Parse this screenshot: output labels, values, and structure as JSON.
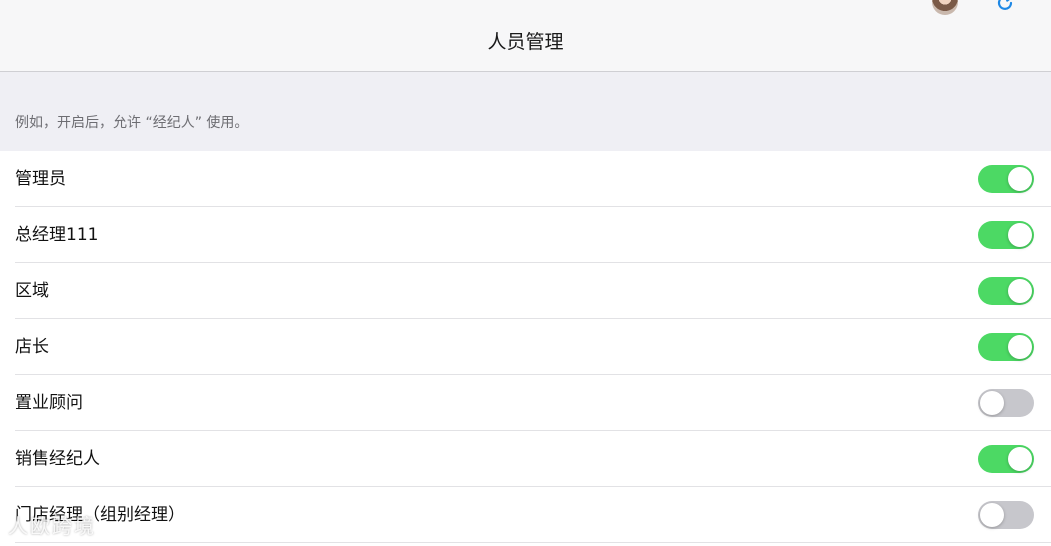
{
  "header": {
    "title": "人员管理"
  },
  "section": {
    "note": "例如，开启后，允许 “经纪人” 使用。"
  },
  "roles": [
    {
      "label": "管理员",
      "enabled": true
    },
    {
      "label": "总经理111",
      "enabled": true
    },
    {
      "label": "区域",
      "enabled": true
    },
    {
      "label": "店长",
      "enabled": true
    },
    {
      "label": "置业顾问",
      "enabled": false
    },
    {
      "label": "销售经纪人",
      "enabled": true
    },
    {
      "label": "门店经理（组别经理）",
      "enabled": false
    }
  ],
  "watermark": "人欧跨境",
  "colors": {
    "switch_on": "#4cd964",
    "switch_off": "#c7c7cc",
    "accent_refresh": "#1e88e5"
  },
  "icons": {
    "avatar": "user-avatar",
    "refresh": "refresh-icon"
  }
}
